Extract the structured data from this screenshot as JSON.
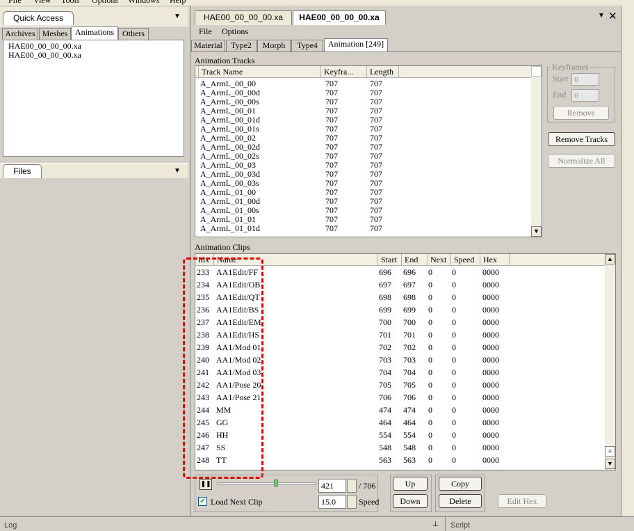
{
  "menubar": [
    "File",
    "View",
    "Tools",
    "Options",
    "Windows",
    "Help"
  ],
  "left": {
    "top_tab": "Quick Access",
    "subtabs": [
      "Archives",
      "Meshes",
      "Animations",
      "Others"
    ],
    "active_subtab": "Animations",
    "files": [
      "HAE00_00_00_00.xa",
      "HAE00_00_00_00.xa"
    ],
    "files_tab": "Files"
  },
  "doc_tabs": [
    "HAE00_00_00_00.xa",
    "HAE00_00_00_00.xa"
  ],
  "editor_menu": [
    "File",
    "Options"
  ],
  "editor_tabs": [
    "Material",
    "Type2",
    "Morph",
    "Type4",
    "Animation [249]"
  ],
  "tracks": {
    "label": "Animation Tracks",
    "headers": [
      "Track Name",
      "Keyfra...",
      "Length"
    ],
    "rows": [
      [
        "A_ArmL_00_00",
        "707",
        "707"
      ],
      [
        "A_ArmL_00_00d",
        "707",
        "707"
      ],
      [
        "A_ArmL_00_00s",
        "707",
        "707"
      ],
      [
        "A_ArmL_00_01",
        "707",
        "707"
      ],
      [
        "A_ArmL_00_01d",
        "707",
        "707"
      ],
      [
        "A_ArmL_00_01s",
        "707",
        "707"
      ],
      [
        "A_ArmL_00_02",
        "707",
        "707"
      ],
      [
        "A_ArmL_00_02d",
        "707",
        "707"
      ],
      [
        "A_ArmL_00_02s",
        "707",
        "707"
      ],
      [
        "A_ArmL_00_03",
        "707",
        "707"
      ],
      [
        "A_ArmL_00_03d",
        "707",
        "707"
      ],
      [
        "A_ArmL_00_03s",
        "707",
        "707"
      ],
      [
        "A_ArmL_01_00",
        "707",
        "707"
      ],
      [
        "A_ArmL_01_00d",
        "707",
        "707"
      ],
      [
        "A_ArmL_01_00s",
        "707",
        "707"
      ],
      [
        "A_ArmL_01_01",
        "707",
        "707"
      ],
      [
        "A_ArmL_01_01d",
        "707",
        "707"
      ]
    ]
  },
  "keyframes": {
    "label": "Keyframes",
    "start_label": "Start",
    "start_value": "0",
    "end_label": "End",
    "end_value": "0",
    "remove": "Remove"
  },
  "buttons": {
    "remove_tracks": "Remove Tracks",
    "normalize_all": "Normalize All",
    "up": "Up",
    "down": "Down",
    "copy": "Copy",
    "delete": "Delete",
    "edit_hex": "Edit Hex"
  },
  "clips": {
    "label": "Animation Clips",
    "headers": [
      "Idx",
      "Name",
      "Start",
      "End",
      "Next",
      "Speed",
      "Hex"
    ],
    "rows": [
      [
        "233",
        "AA1Edit/FF",
        "696",
        "696",
        "0",
        "0",
        "0000"
      ],
      [
        "234",
        "AA1Edit/OB",
        "697",
        "697",
        "0",
        "0",
        "0000"
      ],
      [
        "235",
        "AA1Edit/QT",
        "698",
        "698",
        "0",
        "0",
        "0000"
      ],
      [
        "236",
        "AA1Edit/BS",
        "699",
        "699",
        "0",
        "0",
        "0000"
      ],
      [
        "237",
        "AA1Edit/EM",
        "700",
        "700",
        "0",
        "0",
        "0000"
      ],
      [
        "238",
        "AA1Edit/HS",
        "701",
        "701",
        "0",
        "0",
        "0000"
      ],
      [
        "239",
        "AA1/Mod 01",
        "702",
        "702",
        "0",
        "0",
        "0000"
      ],
      [
        "240",
        "AA1/Mod 02",
        "703",
        "703",
        "0",
        "0",
        "0000"
      ],
      [
        "241",
        "AA1/Mod 03",
        "704",
        "704",
        "0",
        "0",
        "0000"
      ],
      [
        "242",
        "AA1/Pose 20",
        "705",
        "705",
        "0",
        "0",
        "0000"
      ],
      [
        "243",
        "AA1/Pose 21",
        "706",
        "706",
        "0",
        "0",
        "0000"
      ],
      [
        "244",
        "MM",
        "474",
        "474",
        "0",
        "0",
        "0000"
      ],
      [
        "245",
        "GG",
        "464",
        "464",
        "0",
        "0",
        "0000"
      ],
      [
        "246",
        "HH",
        "554",
        "554",
        "0",
        "0",
        "0000"
      ],
      [
        "247",
        "SS",
        "548",
        "548",
        "0",
        "0",
        "0000"
      ],
      [
        "248",
        "TT",
        "563",
        "563",
        "0",
        "0",
        "0000"
      ]
    ]
  },
  "playback": {
    "frame": "421",
    "total": "/ 706",
    "speed_value": "15.0",
    "speed_label": "Speed",
    "load_next_clip": "Load Next Clip",
    "position_fraction": 0.6
  },
  "bottom": {
    "log": "Log",
    "script": "Script"
  }
}
